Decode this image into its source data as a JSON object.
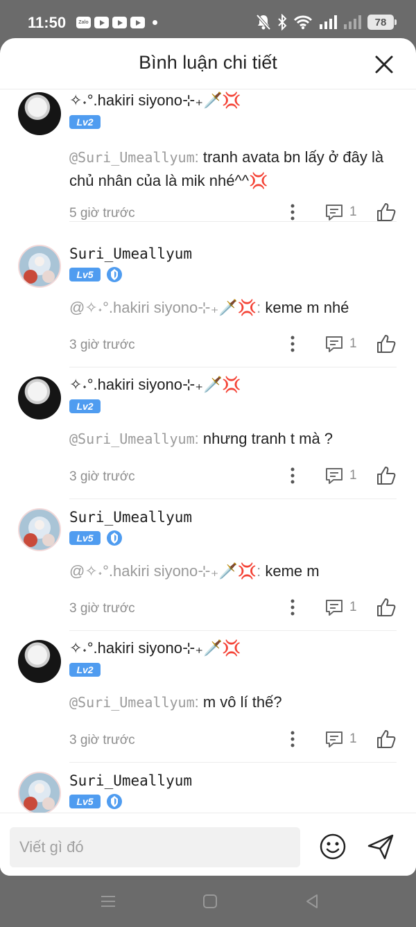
{
  "status_bar": {
    "time": "11:50",
    "app_icons": [
      "zalo-icon",
      "youtube-icon",
      "youtube-icon",
      "youtube-icon"
    ],
    "zalo_label": "Zalo",
    "battery": "78"
  },
  "header": {
    "title": "Bình luận chi tiết"
  },
  "comments": [
    {
      "username": "✧˖°.hakiri siyono⊹₊🗡️💢",
      "level": "Lv2",
      "mention": "@Suri_Umeallyum",
      "text": "tranh avata bn lấy ở đây là chủ nhân của là mik nhé^^💢",
      "time": "5 giờ trước",
      "reply_count": "1"
    },
    {
      "username": "Suri_Umeallyum",
      "level": "Lv5",
      "mention": "@✧˖°.hakiri siyono⊹₊🗡️💢",
      "text": "keme m nhé",
      "time": "3 giờ trước",
      "reply_count": "1"
    },
    {
      "username": "✧˖°.hakiri siyono⊹₊🗡️💢",
      "level": "Lv2",
      "mention": "@Suri_Umeallyum",
      "text": "nhưng tranh t mà ?",
      "time": "3 giờ trước",
      "reply_count": "1"
    },
    {
      "username": "Suri_Umeallyum",
      "level": "Lv5",
      "mention": "@✧˖°.hakiri siyono⊹₊🗡️💢",
      "text": "keme m",
      "time": "3 giờ trước",
      "reply_count": "1"
    },
    {
      "username": "✧˖°.hakiri siyono⊹₊🗡️💢",
      "level": "Lv2",
      "mention": "@Suri_Umeallyum",
      "text": "m vô lí thế?",
      "time": "3 giờ trước",
      "reply_count": "1"
    },
    {
      "username": "Suri_Umeallyum",
      "level": "Lv5"
    }
  ],
  "input": {
    "placeholder": "Viết gì đó"
  },
  "colors": {
    "level_badge": "#4f9cf0",
    "muted_text": "#8d8d8d",
    "background": "#6b6b6b"
  }
}
